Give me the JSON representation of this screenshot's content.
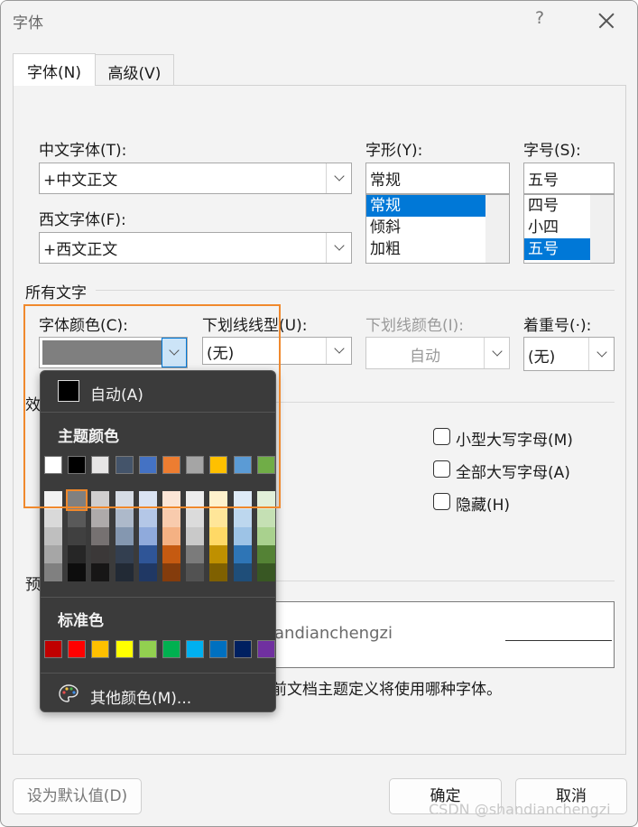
{
  "window": {
    "title": "字体",
    "help": "?"
  },
  "tabs": [
    {
      "label": "字体(N)"
    },
    {
      "label": "高级(V)"
    }
  ],
  "chinese_font": {
    "label": "中文字体(T):",
    "value": "+中文正文"
  },
  "western_font": {
    "label": "西文字体(F):",
    "value": "+西文正文"
  },
  "style": {
    "label": "字形(Y):",
    "value": "常规",
    "items": [
      "常规",
      "倾斜",
      "加粗"
    ],
    "selected": 0
  },
  "size": {
    "label": "字号(S):",
    "value": "五号",
    "items": [
      "四号",
      "小四",
      "五号"
    ],
    "selected": 2
  },
  "all_text": {
    "section": "所有文字",
    "font_color_label": "字体颜色(C):",
    "underline_label": "下划线线型(U):",
    "underline_value": "(无)",
    "underline_color_label": "下划线颜色(I):",
    "underline_color_value": "自动",
    "emphasis_label": "着重号(·):",
    "emphasis_value": "(无)"
  },
  "effects": {
    "section_fragment": "效",
    "checkboxes": [
      {
        "label": "小型大写字母(M)"
      },
      {
        "label": "全部大写字母(A)"
      },
      {
        "label": "隐藏(H)"
      }
    ]
  },
  "preview": {
    "section_fragment": "预",
    "text_fragment": "andianchengzi",
    "note_fragment": "前文档主题定义将使用哪种字体。"
  },
  "buttons": {
    "set_default": "设为默认值(D)",
    "ok": "确定",
    "cancel": "取消"
  },
  "watermark": "CSDN @shandianchengzi",
  "color_picker": {
    "auto_label": "自动(A)",
    "theme_title": "主题颜色",
    "theme_colors": [
      "#FFFFFF",
      "#000000",
      "#E7E6E6",
      "#44546A",
      "#4472C4",
      "#ED7D31",
      "#A5A5A5",
      "#FFC000",
      "#5B9BD5",
      "#70AD47"
    ],
    "theme_shades": [
      [
        "#F2F2F2",
        "#D9D9D9",
        "#BFBFBF",
        "#A6A6A6",
        "#808080"
      ],
      [
        "#808080",
        "#595959",
        "#404040",
        "#262626",
        "#0D0D0D"
      ],
      [
        "#D0CECE",
        "#AEAAAA",
        "#767171",
        "#3B3838",
        "#171616"
      ],
      [
        "#D6DCE5",
        "#ADB9CA",
        "#8497B0",
        "#333F50",
        "#222A35"
      ],
      [
        "#DAE3F3",
        "#B4C7E7",
        "#8FAADC",
        "#2F5597",
        "#203864"
      ],
      [
        "#FBE5D6",
        "#F8CBAD",
        "#F4B183",
        "#C55A11",
        "#843C0C"
      ],
      [
        "#EDEDED",
        "#DBDBDB",
        "#C9C9C9",
        "#7B7B7B",
        "#525252"
      ],
      [
        "#FFF2CC",
        "#FFE699",
        "#FFD966",
        "#BF9000",
        "#7F6000"
      ],
      [
        "#DEEBF7",
        "#BDD7EE",
        "#9DC3E6",
        "#2E75B6",
        "#1F4E79"
      ],
      [
        "#E2F0D9",
        "#C5E0B4",
        "#A9D18E",
        "#548235",
        "#385723"
      ]
    ],
    "standard_title": "标准色",
    "standard_colors": [
      "#C00000",
      "#FF0000",
      "#FFC000",
      "#FFFF00",
      "#92D050",
      "#00B050",
      "#00B0F0",
      "#0070C0",
      "#002060",
      "#7030A0"
    ],
    "more_label": "其他颜色(M)..."
  }
}
